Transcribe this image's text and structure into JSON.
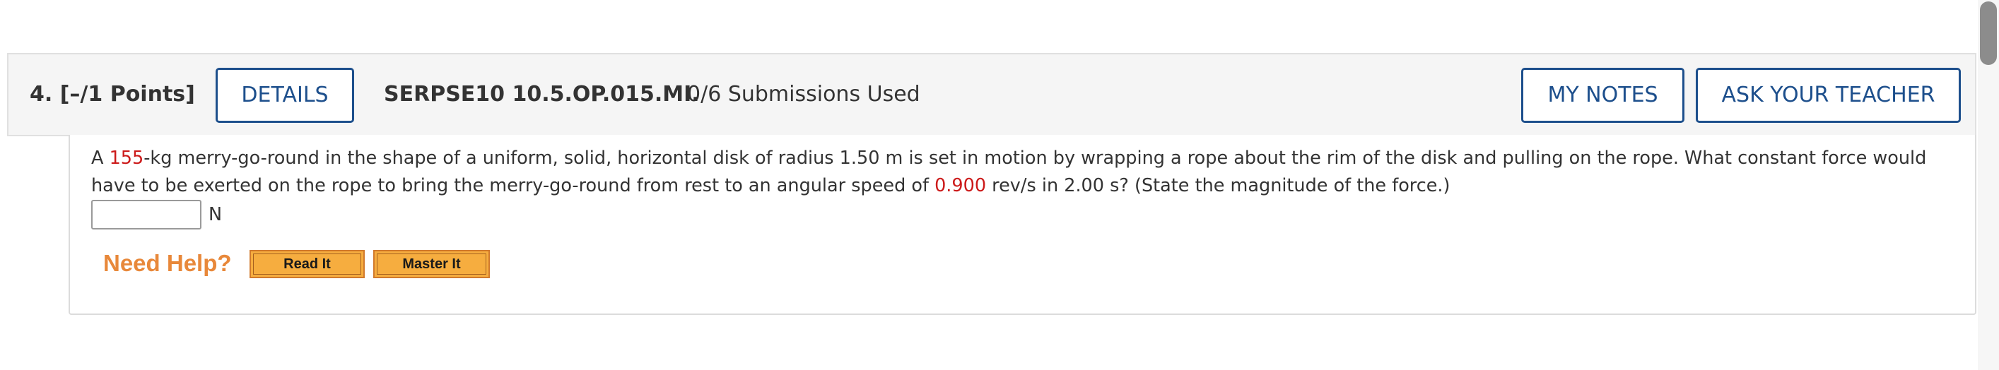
{
  "question": {
    "number_points": "4.  [–/1 Points]",
    "details_button": "DETAILS",
    "assignment_code": "SERPSE10 10.5.OP.015.MI.",
    "submissions": "0/6 Submissions Used",
    "my_notes_button": "MY NOTES",
    "ask_teacher_button": "ASK YOUR TEACHER"
  },
  "problem": {
    "text_1": "A ",
    "mass_value": "155",
    "text_2": "-kg merry-go-round in the shape of a uniform, solid, horizontal disk of radius 1.50 m is set in motion by wrapping a rope about the rim of the disk and pulling on the rope. What constant force would have to be exerted on the rope to bring the merry-go-round from rest to an angular speed of ",
    "speed_value": "0.900",
    "text_3": " rev/s in 2.00 s? (State the magnitude of the force.)",
    "answer_value": "",
    "answer_unit": "N"
  },
  "help": {
    "label": "Need Help?",
    "read_it_button": "Read It",
    "master_it_button": "Master It"
  },
  "colors": {
    "accent_blue": "#1d4f8c",
    "randomized_value_red": "#cc1a1a",
    "need_help_orange": "#e8883a",
    "help_button_fill": "#f6ad3f"
  }
}
